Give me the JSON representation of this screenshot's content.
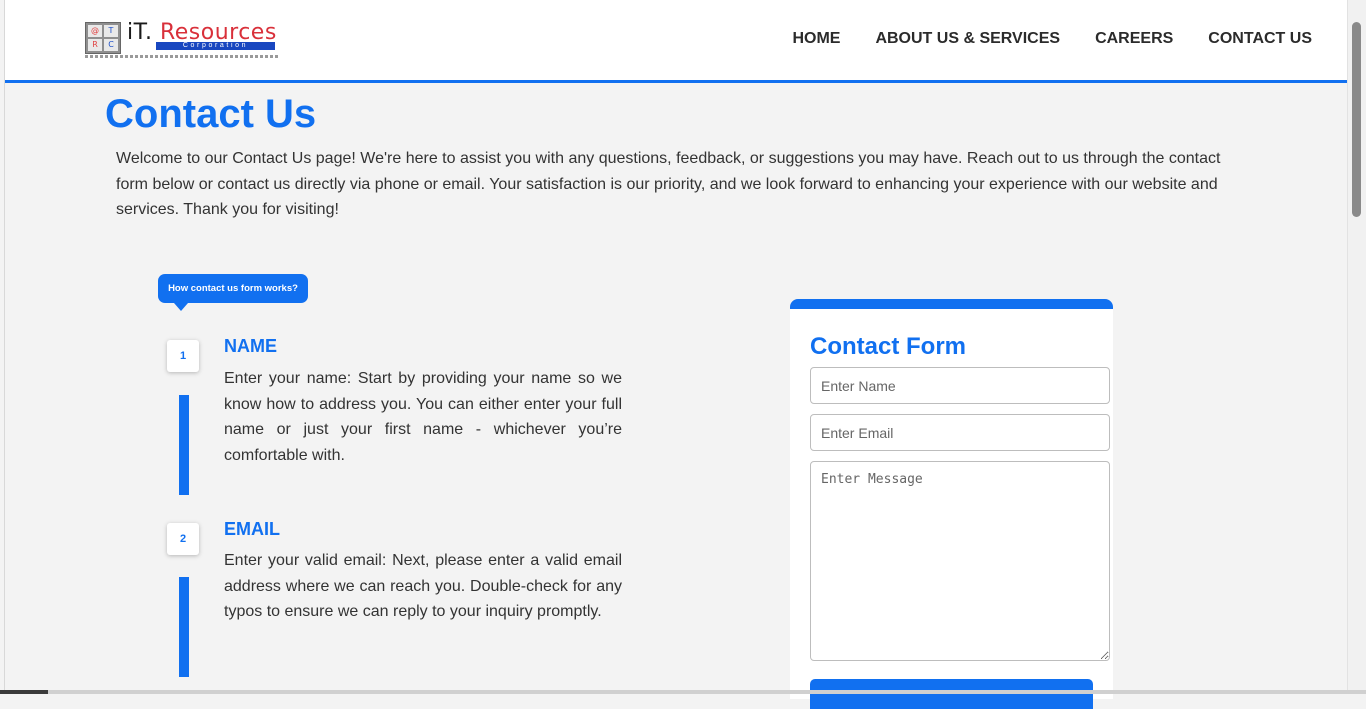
{
  "brand": {
    "logo_cells": [
      "@",
      "T",
      "R",
      "C"
    ],
    "name_prefix": "iT.",
    "name_main": "Resources",
    "sub": "Corporation"
  },
  "nav": {
    "items": [
      "HOME",
      "ABOUT US & SERVICES",
      "CAREERS",
      "CONTACT US"
    ]
  },
  "page": {
    "title": "Contact Us",
    "intro": "Welcome to our Contact Us page! We're here to assist you with any questions, feedback, or suggestions you may have. Reach out to us through the contact form below or contact us directly via phone or email. Your satisfaction is our priority, and we look forward to enhancing your experience with our website and services. Thank you for visiting!"
  },
  "how_it_works": {
    "badge": "How contact us form works?",
    "steps": [
      {
        "number": "1",
        "heading": "NAME",
        "text": "Enter your name: Start by providing your name so we know how to address you. You can either enter your full name or just your first name - whichever you’re comfortable with."
      },
      {
        "number": "2",
        "heading": "EMAIL",
        "text": "Enter your valid email: Next, please enter a valid email address where we can reach you. Double-check for any typos to ensure we can reply to your inquiry promptly."
      }
    ]
  },
  "contact_form": {
    "title": "Contact Form",
    "name_placeholder": "Enter Name",
    "email_placeholder": "Enter Email",
    "message_placeholder": "Enter Message",
    "submit_label": ""
  },
  "colors": {
    "accent": "#1170f0",
    "background": "#f3f3f3",
    "text": "#333333"
  }
}
